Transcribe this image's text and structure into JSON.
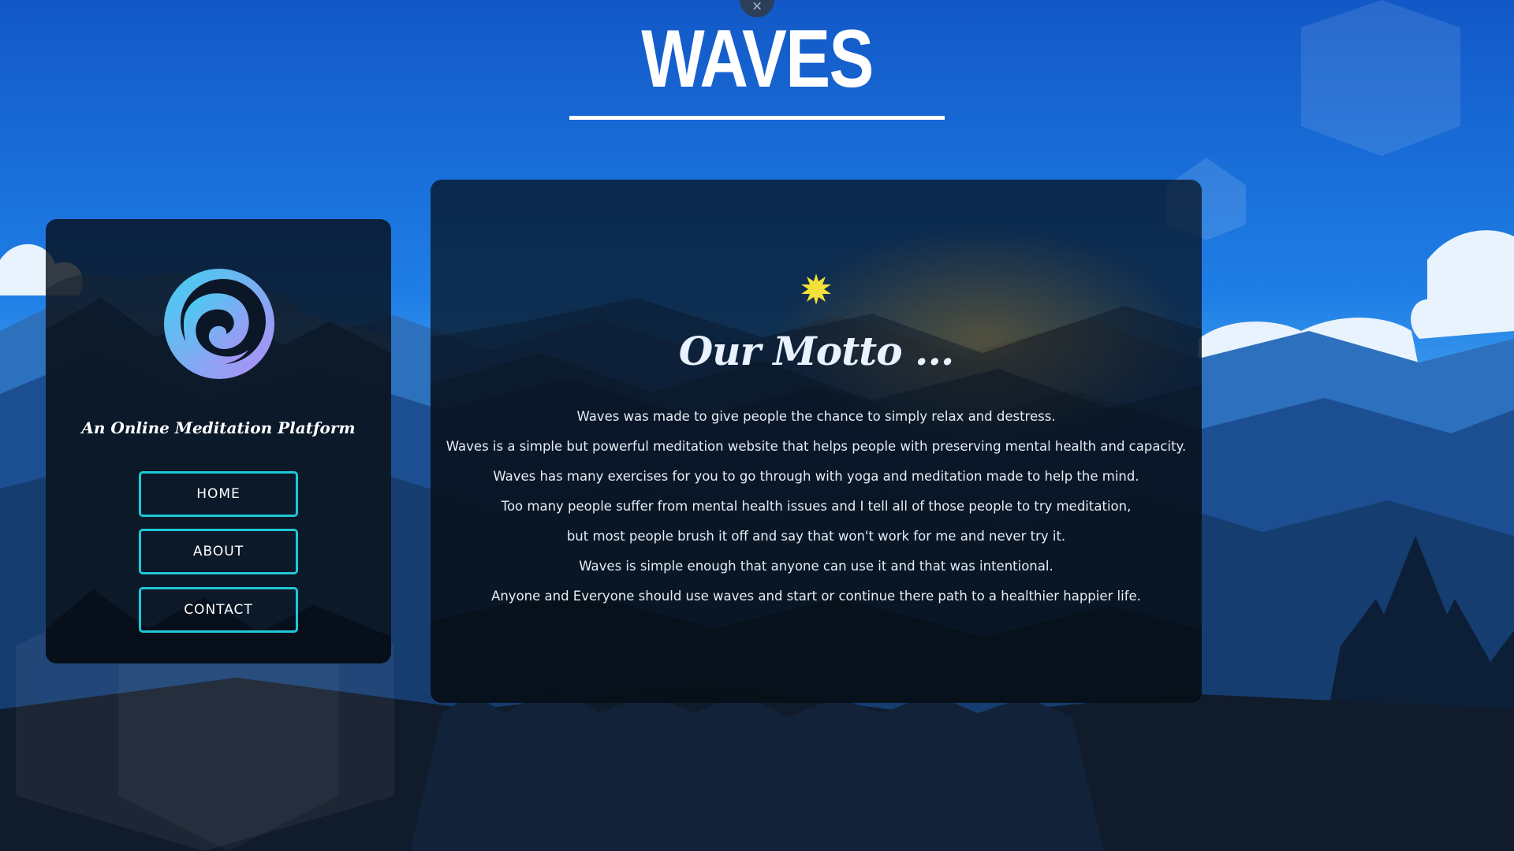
{
  "header": {
    "title": "WAVES",
    "close_icon": "×"
  },
  "sidebar": {
    "tagline": "An Online Meditation Platform",
    "logo_icon": "swirl-wave-logo",
    "nav": [
      {
        "label": "HOME"
      },
      {
        "label": "ABOUT"
      },
      {
        "label": "CONTACT"
      }
    ]
  },
  "main": {
    "sun_icon": "sun-icon",
    "motto_title": "Our Motto ...",
    "motto_lines": [
      "Waves was made to give people the chance to simply relax and destress.",
      "Waves is a simple but powerful meditation website that helps people with preserving mental health and capacity.",
      "Waves has many exercises for you to go through with yoga and meditation made to help the mind.",
      "Too many people suffer from mental health issues and I tell all of those people to try meditation,",
      "but most people brush it off and say that won't work for me and never try it.",
      "Waves is simple enough that anyone can use it and that was intentional.",
      "Anyone and Everyone should use waves and start or continue there path to a healthier happier life."
    ]
  },
  "colors": {
    "accent": "#1fc8d6",
    "sky_top": "#1566d6",
    "sky_bottom": "#3aa3f5",
    "sun": "#f3e03a"
  }
}
